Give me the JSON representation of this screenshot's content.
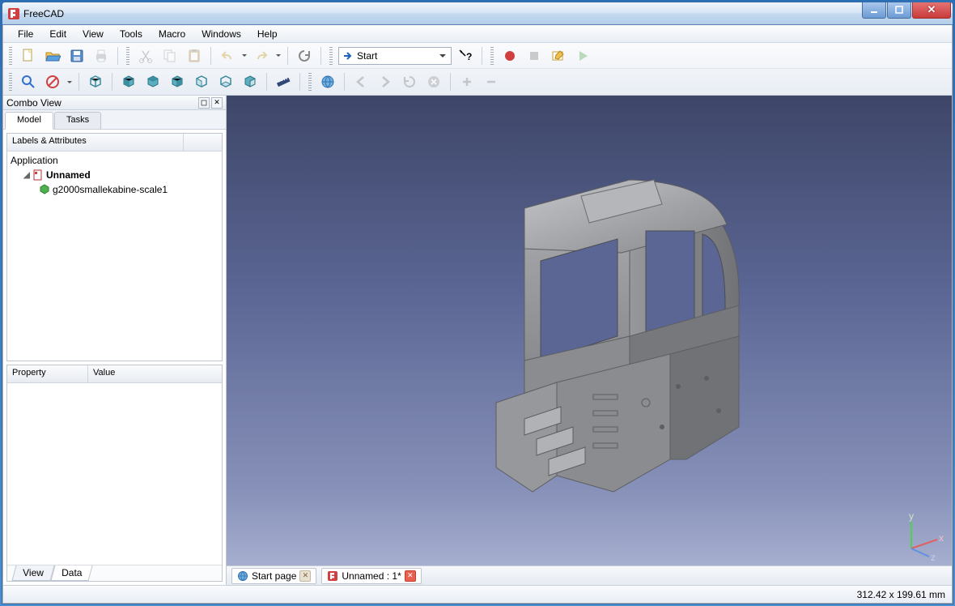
{
  "window": {
    "title": "FreeCAD"
  },
  "menu": {
    "file": "File",
    "edit": "Edit",
    "view": "View",
    "tools": "Tools",
    "macro": "Macro",
    "windows": "Windows",
    "help": "Help"
  },
  "toolbar": {
    "workbench_label": "Start"
  },
  "combo": {
    "title": "Combo View",
    "tabs": {
      "model": "Model",
      "tasks": "Tasks"
    },
    "tree_header": "Labels & Attributes",
    "tree": {
      "root": "Application",
      "doc": "Unnamed",
      "item": "g2000smallekabine-scale1"
    },
    "props": {
      "property": "Property",
      "value": "Value",
      "view_tab": "View",
      "data_tab": "Data"
    }
  },
  "doctabs": {
    "start": "Start page",
    "doc": "Unnamed : 1*"
  },
  "status": {
    "dims": "312.42 x 199.61  mm"
  },
  "axis": {
    "x": "x",
    "y": "y",
    "z": "z"
  }
}
